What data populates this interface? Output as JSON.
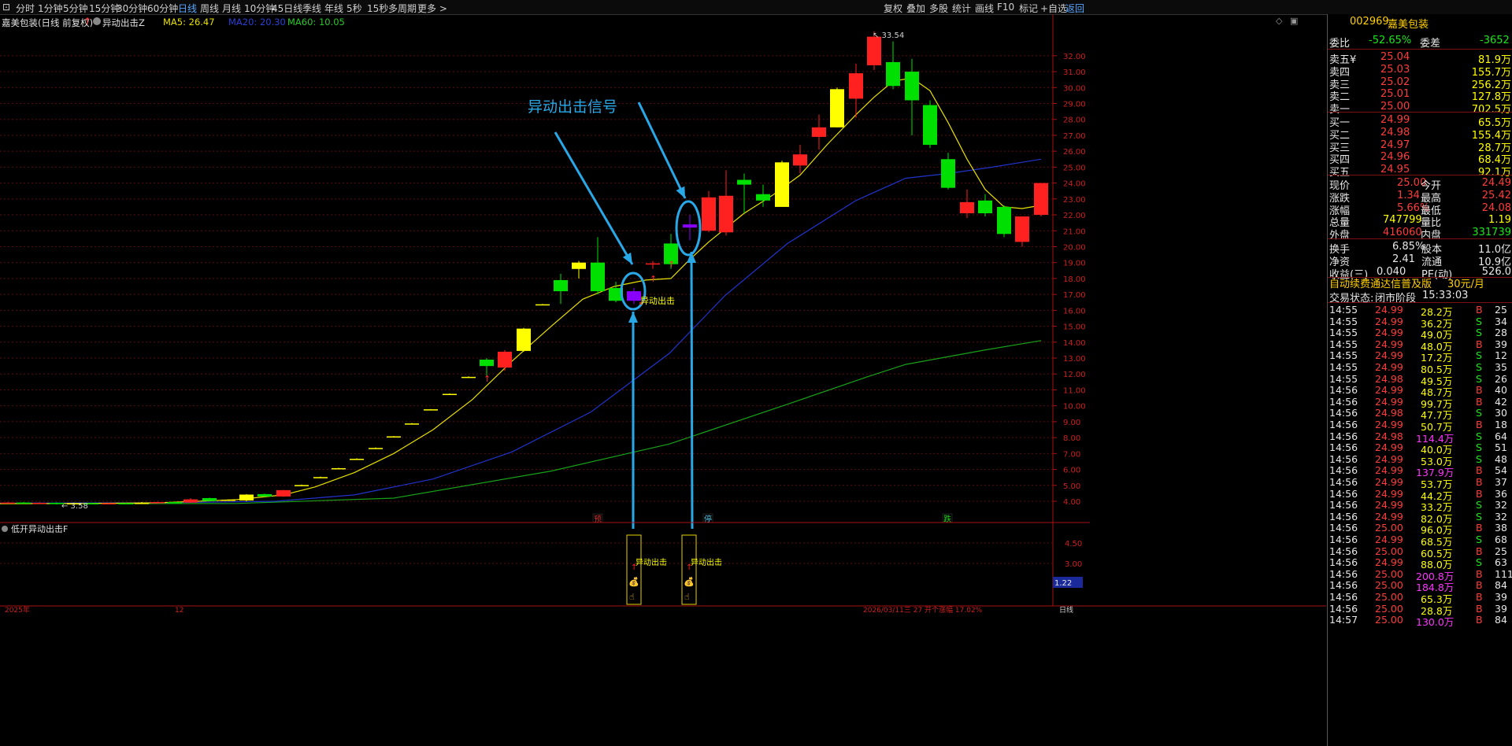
{
  "toolbar": {
    "periods": [
      "分时",
      "1分钟",
      "5分钟",
      "15分钟",
      "30分钟",
      "60分钟",
      "日线",
      "周线",
      "月线",
      "10分钟",
      "45日线",
      "季线",
      "年线",
      "5秒",
      "15秒",
      "多周期",
      "更多 >"
    ],
    "active_period": "日线",
    "right_buttons": [
      "复权",
      "叠加",
      "多股",
      "统计",
      "画线",
      "F10",
      "标记",
      "+自选",
      "返回"
    ]
  },
  "info_bar": {
    "stock": "嘉美包装(日线 前复权)",
    "indicator": "异动出击Z",
    "ma5": "MA5: 26.47",
    "ma20": "MA20: 20.30",
    "ma60": "MA60: 10.05"
  },
  "sub_panel": {
    "title": "低开异动出击F",
    "axis": [
      "4.50",
      "3.00"
    ],
    "current": "1.22",
    "signal_label": "异动出击"
  },
  "annotations": {
    "title": "异动出击信号",
    "signal_label": "异动出击",
    "high_label": "33.54",
    "low_label": "3.58",
    "markers": [
      "预",
      "停",
      "跌"
    ]
  },
  "price_axis": [
    "32.00",
    "31.00",
    "30.00",
    "29.00",
    "28.00",
    "27.00",
    "26.00",
    "25.00",
    "24.00",
    "23.00",
    "22.00",
    "21.00",
    "20.00",
    "19.00",
    "18.00",
    "17.00",
    "16.00",
    "15.00",
    "14.00",
    "13.00",
    "12.00",
    "11.00",
    "10.00",
    "9.00",
    "8.00",
    "7.00",
    "6.00",
    "5.00",
    "4.00"
  ],
  "bottom_bar": {
    "left": "2025年",
    "mid": "12",
    "status": "2026/03/11三 27 开个涨幅 17.02%",
    "right": "日线"
  },
  "colors": {
    "up": "#ff2020",
    "down": "#00e000",
    "doji": "#ffff00",
    "signal": "#8a00ff",
    "ma5": "#e8e000",
    "ma20": "#2233cc",
    "ma60": "#18a018",
    "callout": "#29a8e8"
  },
  "quote": {
    "code": "002969",
    "name": "嘉美包装",
    "weibi_label": "委比",
    "weibi": "-52.65%",
    "weicha_label": "委差",
    "weicha": "-3652",
    "sell": [
      {
        "label": "卖五",
        "price": "25.04",
        "vol": "81.9万"
      },
      {
        "label": "卖四",
        "price": "25.03",
        "vol": "155.7万"
      },
      {
        "label": "卖三",
        "price": "25.02",
        "vol": "256.2万"
      },
      {
        "label": "卖二",
        "price": "25.01",
        "vol": "127.8万"
      },
      {
        "label": "卖一",
        "price": "25.00",
        "vol": "702.5万"
      }
    ],
    "buy": [
      {
        "label": "买一",
        "price": "24.99",
        "vol": "65.5万"
      },
      {
        "label": "买二",
        "price": "24.98",
        "vol": "155.4万"
      },
      {
        "label": "买三",
        "price": "24.97",
        "vol": "28.7万"
      },
      {
        "label": "买四",
        "price": "24.96",
        "vol": "68.4万"
      },
      {
        "label": "买五",
        "price": "24.95",
        "vol": "92.1万"
      }
    ],
    "stats": [
      {
        "l1": "现价",
        "v1": "25.00",
        "l2": "今开",
        "v2": "24.49"
      },
      {
        "l1": "涨跌",
        "v1": "1.34",
        "l2": "最高",
        "v2": "25.42"
      },
      {
        "l1": "涨幅",
        "v1": "5.66%",
        "l2": "最低",
        "v2": "24.08"
      },
      {
        "l1": "总量",
        "v1": "747799",
        "l2": "量比",
        "v2": "1.19"
      },
      {
        "l1": "外盘",
        "v1": "416060",
        "l2": "内盘",
        "v2": "331739"
      }
    ],
    "stats2": [
      {
        "l1": "换手",
        "v1": "6.85%",
        "l2": "股本",
        "v2": "11.0亿"
      },
      {
        "l1": "净资",
        "v1": "2.41",
        "l2": "流通",
        "v2": "10.9亿"
      },
      {
        "l1": "收益(三)",
        "v1": "0.040",
        "l2": "PE(动)",
        "v2": "526.0"
      }
    ],
    "promo": "自动续费通达信普及版",
    "promo_price": "30元/月",
    "status_label": "交易状态:",
    "status": "闭市阶段",
    "status_time": "15:33:03"
  },
  "ticks": [
    {
      "t": "14:55",
      "p": "24.99",
      "v": "28.2万",
      "s": "B",
      "n": "25"
    },
    {
      "t": "14:55",
      "p": "24.99",
      "v": "36.2万",
      "s": "S",
      "n": "34"
    },
    {
      "t": "14:55",
      "p": "24.99",
      "v": "49.0万",
      "s": "S",
      "n": "28"
    },
    {
      "t": "14:55",
      "p": "24.99",
      "v": "48.0万",
      "s": "B",
      "n": "39"
    },
    {
      "t": "14:55",
      "p": "24.99",
      "v": "17.2万",
      "s": "S",
      "n": "12"
    },
    {
      "t": "14:55",
      "p": "24.99",
      "v": "80.5万",
      "s": "S",
      "n": "35"
    },
    {
      "t": "14:55",
      "p": "24.98",
      "v": "49.5万",
      "s": "S",
      "n": "26"
    },
    {
      "t": "14:56",
      "p": "24.99",
      "v": "48.7万",
      "s": "B",
      "n": "40"
    },
    {
      "t": "14:56",
      "p": "24.99",
      "v": "99.7万",
      "s": "B",
      "n": "42"
    },
    {
      "t": "14:56",
      "p": "24.98",
      "v": "47.7万",
      "s": "S",
      "n": "30"
    },
    {
      "t": "14:56",
      "p": "24.99",
      "v": "50.7万",
      "s": "B",
      "n": "18"
    },
    {
      "t": "14:56",
      "p": "24.98",
      "v": "114.4万",
      "s": "S",
      "n": "64"
    },
    {
      "t": "14:56",
      "p": "24.99",
      "v": "40.0万",
      "s": "S",
      "n": "51"
    },
    {
      "t": "14:56",
      "p": "24.99",
      "v": "53.0万",
      "s": "S",
      "n": "48"
    },
    {
      "t": "14:56",
      "p": "24.99",
      "v": "137.9万",
      "s": "B",
      "n": "54"
    },
    {
      "t": "14:56",
      "p": "24.99",
      "v": "53.7万",
      "s": "B",
      "n": "37"
    },
    {
      "t": "14:56",
      "p": "24.99",
      "v": "44.2万",
      "s": "B",
      "n": "36"
    },
    {
      "t": "14:56",
      "p": "24.99",
      "v": "33.2万",
      "s": "S",
      "n": "32"
    },
    {
      "t": "14:56",
      "p": "24.99",
      "v": "82.0万",
      "s": "S",
      "n": "32"
    },
    {
      "t": "14:56",
      "p": "25.00",
      "v": "96.0万",
      "s": "B",
      "n": "38"
    },
    {
      "t": "14:56",
      "p": "24.99",
      "v": "68.5万",
      "s": "S",
      "n": "68"
    },
    {
      "t": "14:56",
      "p": "25.00",
      "v": "60.5万",
      "s": "B",
      "n": "25"
    },
    {
      "t": "14:56",
      "p": "24.99",
      "v": "88.0万",
      "s": "S",
      "n": "63"
    },
    {
      "t": "14:56",
      "p": "25.00",
      "v": "200.8万",
      "s": "B",
      "n": "111"
    },
    {
      "t": "14:56",
      "p": "25.00",
      "v": "184.8万",
      "s": "B",
      "n": "84"
    },
    {
      "t": "14:56",
      "p": "25.00",
      "v": "65.3万",
      "s": "B",
      "n": "39"
    },
    {
      "t": "14:56",
      "p": "25.00",
      "v": "28.8万",
      "s": "B",
      "n": "39"
    },
    {
      "t": "14:57",
      "p": "25.00",
      "v": "130.0万",
      "s": "B",
      "n": "84"
    }
  ]
}
